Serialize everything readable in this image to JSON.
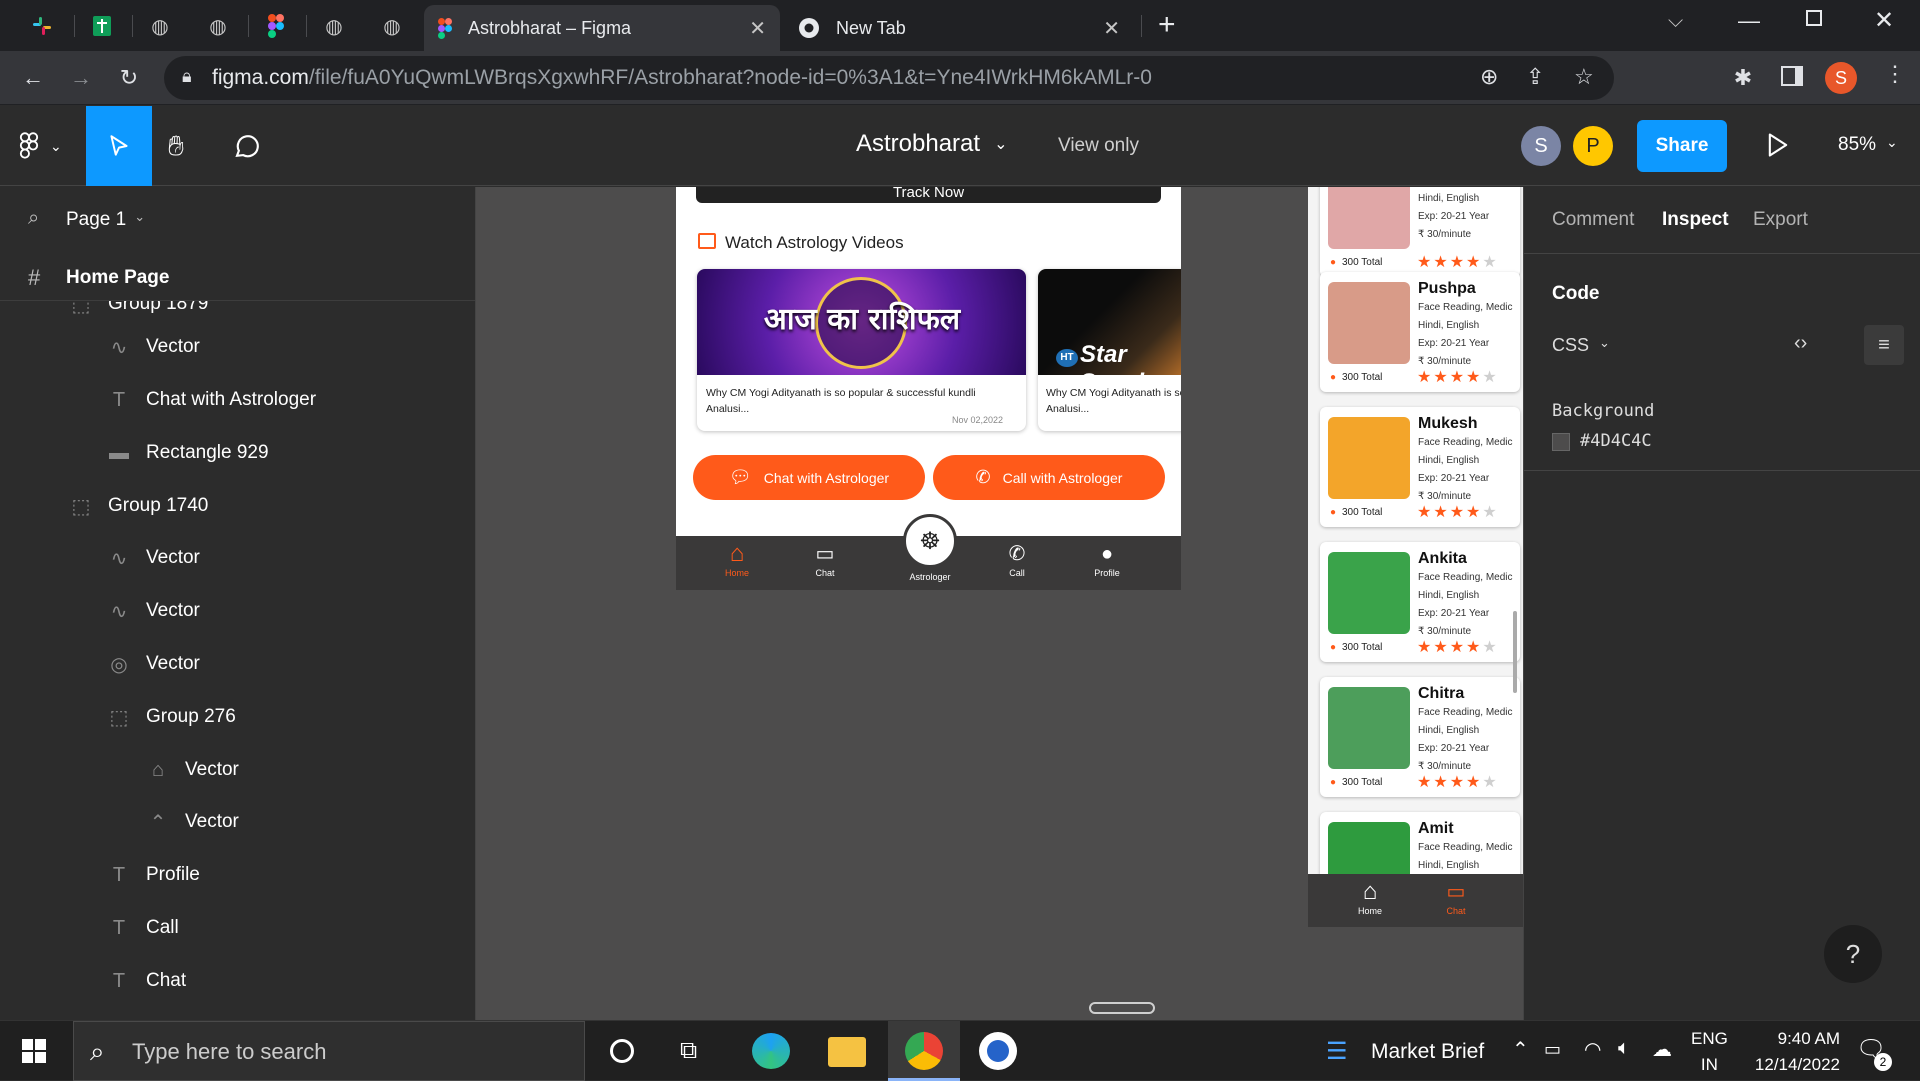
{
  "browser": {
    "tabs": [
      {
        "label": "Astrobharat – Figma",
        "icon": "figma-icon"
      },
      {
        "label": "New Tab",
        "icon": "chrome-icon"
      }
    ],
    "url_host": "figma.com",
    "url_path": "/file/fuA0YuQwmLWBrqsXgxwhRF/Astrobharat?node-id=0%3A1&t=Yne4IWrkHM6kAMLr-0",
    "profile_initial": "S",
    "new_tab_symbol": "+"
  },
  "figma": {
    "file_name": "Astrobharat",
    "view_mode": "View only",
    "avatars": [
      {
        "initial": "S",
        "color": "#7b85a5"
      },
      {
        "initial": "P",
        "color": "#ffc700"
      }
    ],
    "share_label": "Share",
    "zoom": "85%",
    "accent": "#0d99ff"
  },
  "left_panel": {
    "page_label": "Page 1",
    "frame_label": "Home Page",
    "layers": [
      {
        "name": "Group 1879",
        "icon": "group-icon"
      },
      {
        "name": "Vector",
        "icon": "vector-icon"
      },
      {
        "name": "Chat with Astrologer",
        "icon": "text-icon"
      },
      {
        "name": "Rectangle 929",
        "icon": "rectangle-icon"
      },
      {
        "name": "Group 1740",
        "icon": "group-icon"
      },
      {
        "name": "Vector",
        "icon": "vector-icon"
      },
      {
        "name": "Vector",
        "icon": "vector-icon"
      },
      {
        "name": "Vector",
        "icon": "vector-circle-icon"
      },
      {
        "name": "Group 276",
        "icon": "group-icon"
      },
      {
        "name": "Vector",
        "icon": "home-vector-icon"
      },
      {
        "name": "Vector",
        "icon": "roof-vector-icon"
      },
      {
        "name": "Profile",
        "icon": "text-icon"
      },
      {
        "name": "Call",
        "icon": "text-icon"
      },
      {
        "name": "Chat",
        "icon": "text-icon"
      }
    ]
  },
  "right_panel": {
    "tabs": [
      "Comment",
      "Inspect",
      "Export"
    ],
    "active_tab": "Inspect",
    "code_heading": "Code",
    "code_lang": "CSS",
    "background_label": "Background",
    "background_value": "#4D4C4C",
    "help_symbol": "?"
  },
  "app_screen": {
    "track_button": "Track Now",
    "videos_heading": "Watch Astrology Videos",
    "videos": [
      {
        "thumb_text": "आज का राशिफल",
        "caption": "Why CM Yogi Adityanath is so popular & successful kundli Analusi...",
        "date": "Nov 02,2022"
      },
      {
        "thumb_text": "Star Speak",
        "thumb_badge": "HT",
        "caption": "Why CM Yogi Adityanath is so popular & successful kundli Analusi...",
        "date": ""
      }
    ],
    "chat_button": "Chat with Astrologer",
    "call_button": "Call with Astrologer",
    "bottom_nav": [
      {
        "label": "Home",
        "icon": "home-icon",
        "active": true
      },
      {
        "label": "Chat",
        "icon": "chat-icon",
        "active": false
      },
      {
        "label": "Astrologer",
        "icon": "astrologer-icon",
        "active": false
      },
      {
        "label": "Call",
        "icon": "phone-icon",
        "active": false
      },
      {
        "label": "Profile",
        "icon": "profile-icon",
        "active": false
      }
    ],
    "accent": "#ff5a1a"
  },
  "astrologer_list": {
    "cards": [
      {
        "name": "",
        "skills": "",
        "languages": "Hindi, English",
        "experience": "Exp: 20-21 Year",
        "price": "₹ 30/minute",
        "total": "300 Total",
        "rating": 4,
        "photo_bg": "#e0a7a7"
      },
      {
        "name": "Pushpa",
        "skills": "Face Reading, Medic",
        "languages": "Hindi, English",
        "experience": "Exp: 20-21 Year",
        "price": "₹ 30/minute",
        "total": "300 Total",
        "rating": 4,
        "photo_bg": "#d89b88"
      },
      {
        "name": "Mukesh",
        "skills": "Face Reading, Medic",
        "languages": "Hindi, English",
        "experience": "Exp: 20-21 Year",
        "price": "₹ 30/minute",
        "total": "300 Total",
        "rating": 4,
        "photo_bg": "#f3a52a"
      },
      {
        "name": "Ankita",
        "skills": "Face Reading, Medic",
        "languages": "Hindi, English",
        "experience": "Exp: 20-21 Year",
        "price": "₹ 30/minute",
        "total": "300 Total",
        "rating": 4,
        "photo_bg": "#3aa34a"
      },
      {
        "name": "Chitra",
        "skills": "Face Reading, Medic",
        "languages": "Hindi, English",
        "experience": "Exp: 20-21 Year",
        "price": "₹ 30/minute",
        "total": "300 Total",
        "rating": 4,
        "photo_bg": "#4d9e5b"
      },
      {
        "name": "Amit",
        "skills": "Face Reading, Medic",
        "languages": "Hindi, English",
        "experience": "",
        "price": "",
        "total": "",
        "rating": 0,
        "photo_bg": "#2e9b3e"
      }
    ],
    "nav": [
      {
        "label": "Home",
        "icon": "home-icon",
        "active": false
      },
      {
        "label": "Chat",
        "icon": "chat-icon",
        "active": true
      }
    ]
  },
  "taskbar": {
    "search_placeholder": "Type here to search",
    "news_label": "Market Brief",
    "lang_top": "ENG",
    "lang_bottom": "IN",
    "time": "9:40 AM",
    "date": "12/14/2022",
    "notification_count": "2"
  }
}
